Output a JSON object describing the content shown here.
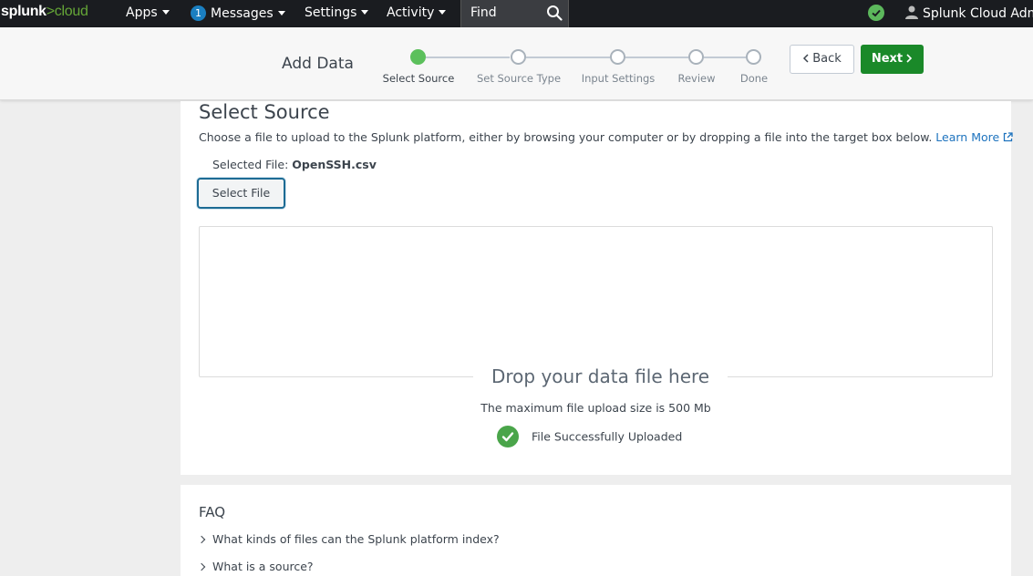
{
  "topnav": {
    "logo_main": "splunk",
    "logo_suffix": ">cloud",
    "apps": "Apps",
    "messages_count": "1",
    "messages": "Messages",
    "settings": "Settings",
    "activity": "Activity",
    "find": "Find",
    "user": "Splunk Cloud Admin"
  },
  "wizard": {
    "title": "Add Data",
    "steps": [
      "Select Source",
      "Set Source Type",
      "Input Settings",
      "Review",
      "Done"
    ],
    "active_step": 0,
    "back": "Back",
    "next": "Next"
  },
  "main": {
    "title": "Select Source",
    "description": "Choose a file to upload to the Splunk platform, either by browsing your computer or by dropping a file into the target box below.",
    "learn_more": "Learn More",
    "selected_file_label": "Selected File:",
    "selected_file_name": "OpenSSH.csv",
    "select_file_button": "Select File",
    "drop_title": "Drop your data file here",
    "max_size": "The maximum file upload size is 500 Mb",
    "upload_status": "File Successfully Uploaded"
  },
  "faq": {
    "title": "FAQ",
    "items": [
      "What kinds of files can the Splunk platform index?",
      "What is a source?"
    ]
  },
  "colors": {
    "topnav_bg": "#1a1c20",
    "accent_green": "#1a8929",
    "step_active": "#5cc05c",
    "link": "#1e73be"
  }
}
